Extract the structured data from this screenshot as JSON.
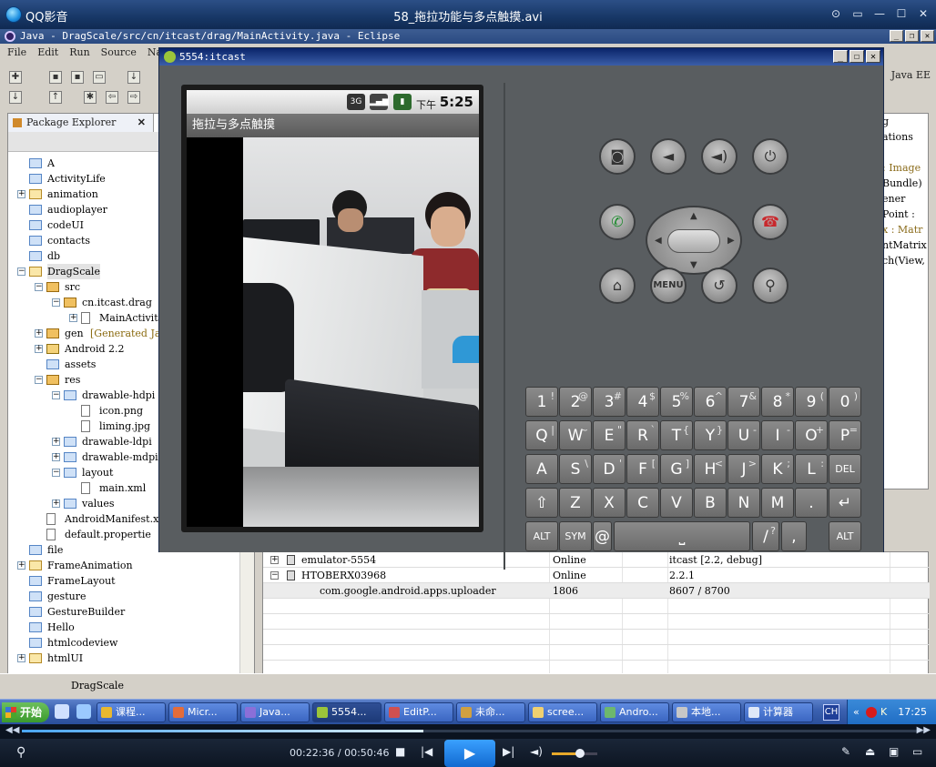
{
  "qq": {
    "app_name": "QQ影音",
    "file_name": "58_拖拉功能与多点触摸.avi",
    "controls": [
      "pin-icon",
      "mini-mode-icon",
      "minimize-icon",
      "maximize-icon",
      "close-icon"
    ]
  },
  "eclipse": {
    "title": "Java - DragScale/src/cn/itcast/drag/MainActivity.java - Eclipse",
    "menu": [
      "File",
      "Edit",
      "Run",
      "Source",
      "Nav"
    ],
    "perspective": "Java EE",
    "package_explorer": {
      "tab_label": "Package Explorer",
      "items": [
        {
          "label": "A",
          "icon": "folder",
          "expander": ""
        },
        {
          "label": "ActivityLife",
          "icon": "folder",
          "expander": ""
        },
        {
          "label": "animation",
          "icon": "proj",
          "expander": "+"
        },
        {
          "label": "audioplayer",
          "icon": "folder",
          "expander": ""
        },
        {
          "label": "codeUI",
          "icon": "folder",
          "expander": ""
        },
        {
          "label": "contacts",
          "icon": "folder",
          "expander": ""
        },
        {
          "label": "db",
          "icon": "folder",
          "expander": ""
        },
        {
          "label": "DragScale",
          "icon": "proj",
          "expander": "−"
        },
        {
          "label": "src",
          "icon": "pkg",
          "expander": "−"
        },
        {
          "label": "cn.itcast.drag",
          "icon": "pkg",
          "expander": "−"
        },
        {
          "label": "MainActivit",
          "icon": "file",
          "expander": "+"
        },
        {
          "label": "gen",
          "extra": "[Generated Ja",
          "icon": "pkg",
          "expander": "+"
        },
        {
          "label": "Android 2.2",
          "icon": "lib",
          "expander": "+"
        },
        {
          "label": "assets",
          "icon": "folder",
          "expander": ""
        },
        {
          "label": "res",
          "icon": "pkg",
          "expander": "−"
        },
        {
          "label": "drawable-hdpi",
          "icon": "folder",
          "expander": "−"
        },
        {
          "label": "icon.png",
          "icon": "file",
          "expander": ""
        },
        {
          "label": "liming.jpg",
          "icon": "file",
          "expander": ""
        },
        {
          "label": "drawable-ldpi",
          "icon": "folder",
          "expander": "+"
        },
        {
          "label": "drawable-mdpi",
          "icon": "folder",
          "expander": "+"
        },
        {
          "label": "layout",
          "icon": "folder",
          "expander": "−"
        },
        {
          "label": "main.xml",
          "icon": "file",
          "expander": ""
        },
        {
          "label": "values",
          "icon": "folder",
          "expander": "+"
        },
        {
          "label": "AndroidManifest.x",
          "icon": "file",
          "expander": ""
        },
        {
          "label": "default.propertie",
          "icon": "file",
          "expander": ""
        },
        {
          "label": "file",
          "icon": "folder",
          "expander": ""
        },
        {
          "label": "FrameAnimation",
          "icon": "proj",
          "expander": "+"
        },
        {
          "label": "FrameLayout",
          "icon": "folder",
          "expander": ""
        },
        {
          "label": "gesture",
          "icon": "folder",
          "expander": ""
        },
        {
          "label": "GestureBuilder",
          "icon": "folder",
          "expander": ""
        },
        {
          "label": "Hello",
          "icon": "folder",
          "expander": ""
        },
        {
          "label": "htmlcodeview",
          "icon": "folder",
          "expander": ""
        },
        {
          "label": "htmlUI",
          "icon": "proj",
          "expander": "+"
        }
      ]
    },
    "outline_lines": [
      "g",
      "ations",
      "",
      " : Image",
      "Bundle)",
      "ener",
      "Point :",
      "x : Matr",
      "ntMatrix",
      "ch(View,"
    ],
    "devices": {
      "rows": [
        {
          "name": "emulator-5554",
          "state": "Online",
          "info": "itcast [2.2, debug]",
          "expander": "+"
        },
        {
          "name": "HTOBERX03968",
          "state": "Online",
          "info": "2.2.1",
          "expander": "−"
        },
        {
          "name": "com.google.android.apps.uploader",
          "state": "1806",
          "info": "8607 / 8700",
          "expander": ""
        }
      ]
    },
    "status_text": "DragScale"
  },
  "emulator": {
    "title": "5554:itcast",
    "status_bar": {
      "ampm": "下午",
      "time": "5:25",
      "network": "3G"
    },
    "app_title": "拖拉与多点触摸",
    "hw_buttons": [
      "camera-icon",
      "volume-down-icon",
      "volume-up-icon",
      "power-icon",
      "call-icon",
      "end-call-icon",
      "home-icon",
      "MENU",
      "back-icon",
      "search-icon"
    ],
    "keyboard": {
      "row1": [
        [
          "1",
          "!"
        ],
        [
          "2",
          "@"
        ],
        [
          "3",
          "#"
        ],
        [
          "4",
          "$"
        ],
        [
          "5",
          "%"
        ],
        [
          "6",
          "^"
        ],
        [
          "7",
          "&"
        ],
        [
          "8",
          "*"
        ],
        [
          "9",
          "("
        ],
        [
          "0",
          ")"
        ]
      ],
      "row2": [
        [
          "Q",
          "|"
        ],
        [
          "W",
          "~"
        ],
        [
          "E",
          "\""
        ],
        [
          "R",
          "`"
        ],
        [
          "T",
          "{"
        ],
        [
          "Y",
          "}"
        ],
        [
          "U",
          "-"
        ],
        [
          "I",
          "-"
        ],
        [
          "O",
          "+"
        ],
        [
          "P",
          "="
        ]
      ],
      "row3": [
        [
          "A",
          ""
        ],
        [
          "S",
          "\\"
        ],
        [
          "D",
          "'"
        ],
        [
          "F",
          "["
        ],
        [
          "G",
          "]"
        ],
        [
          "H",
          "<"
        ],
        [
          "J",
          ">"
        ],
        [
          "K",
          ";"
        ],
        [
          "L",
          ":"
        ]
      ],
      "row4": [
        "Z",
        "X",
        "C",
        "V",
        "B",
        "N",
        "M",
        "."
      ],
      "del": "DEL",
      "alt": "ALT",
      "sym": "SYM",
      "at": "@",
      "slash": "/",
      "question": "?",
      "comma": ","
    }
  },
  "taskbar": {
    "start": "开始",
    "buttons": [
      "课程...",
      "Micr...",
      "Java...",
      "5554...",
      "EditP...",
      "未命...",
      "scree...",
      "Andro...",
      "本地...",
      "计算器"
    ],
    "ime": "CH",
    "clock": "17:25"
  },
  "player": {
    "time": "00:22:36 / 00:50:46",
    "progress": 0.445
  }
}
